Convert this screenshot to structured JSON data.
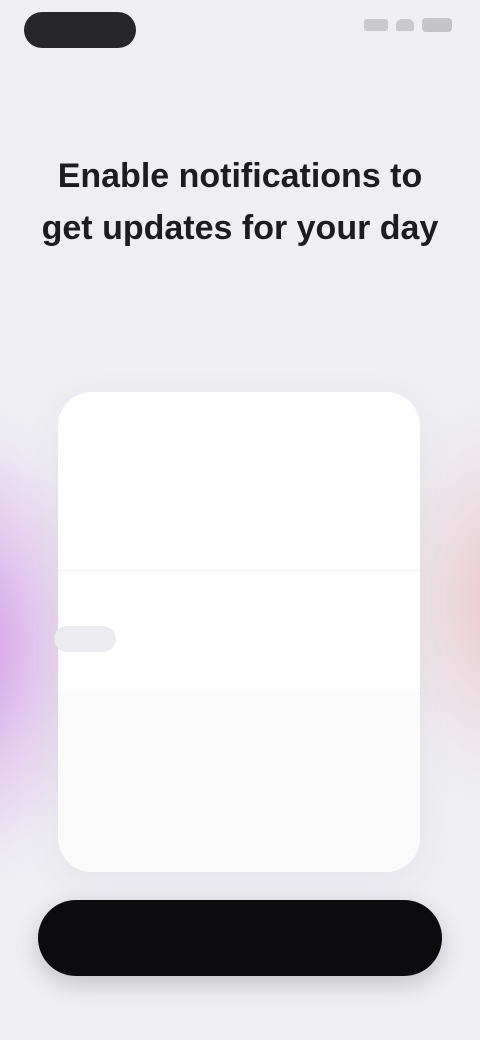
{
  "status_bar": {
    "time": "",
    "icons": [
      "signal-icon",
      "wifi-icon",
      "battery-icon"
    ]
  },
  "top_label": "",
  "headline": "Enable notifications to get updates for your day",
  "card": {
    "app_name": "",
    "notice_text": "",
    "question_text": "",
    "footer_label": ""
  },
  "pointer_chip": "",
  "cta": {
    "label": ""
  },
  "colors": {
    "background": "#eeeef3",
    "card": "#ffffff",
    "cta_background": "#0c0c0f",
    "cta_text": "#ffffff",
    "glow_left": "#cd8ce1",
    "glow_right": "#e6b9be"
  }
}
